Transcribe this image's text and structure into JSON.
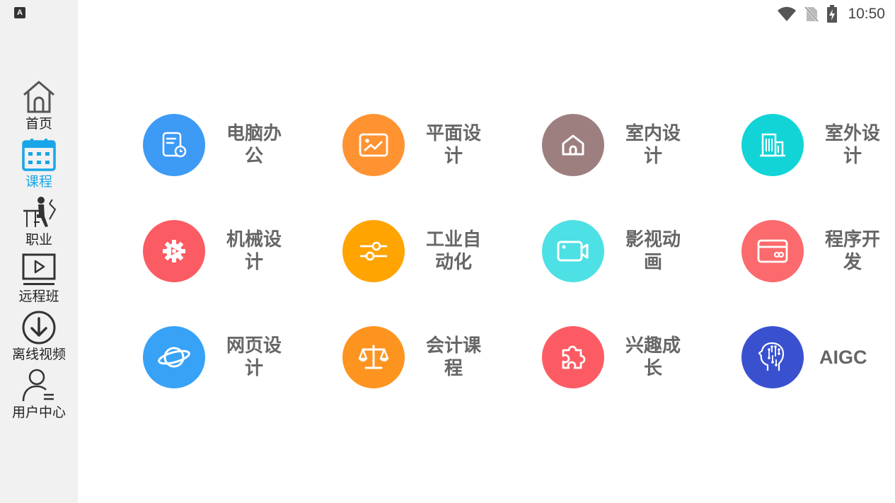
{
  "status": {
    "time": "10:50"
  },
  "app_badge": "A",
  "sidebar": {
    "items": [
      {
        "label": "首页"
      },
      {
        "label": "课程"
      },
      {
        "label": "职业"
      },
      {
        "label": "远程班"
      },
      {
        "label": "离线视频"
      },
      {
        "label": "用户中心"
      }
    ],
    "active_index": 1,
    "active_color": "#18a6e8"
  },
  "categories": [
    {
      "line1": "电脑办",
      "line2": "公",
      "color": "#3d9af5",
      "icon": "document-clock-icon"
    },
    {
      "line1": "平面设",
      "line2": "计",
      "color": "#ff9332",
      "icon": "picture-icon"
    },
    {
      "line1": "室内设",
      "line2": "计",
      "color": "#9d7f80",
      "icon": "house-icon"
    },
    {
      "line1": "室外设",
      "line2": "计",
      "color": "#12d4d6",
      "icon": "building-icon"
    },
    {
      "line1": "机械设",
      "line2": "计",
      "color": "#fb5b62",
      "icon": "gear-icon"
    },
    {
      "line1": "工业自",
      "line2": "动化",
      "color": "#ffa400",
      "icon": "sliders-icon"
    },
    {
      "line1": "影视动",
      "line2": "画",
      "color": "#4de0e4",
      "icon": "video-camera-icon"
    },
    {
      "line1": "程序开",
      "line2": "发",
      "color": "#fb6a6c",
      "icon": "card-code-icon"
    },
    {
      "line1": "网页设",
      "line2": "计",
      "color": "#37a2f6",
      "icon": "planet-icon"
    },
    {
      "line1": "会计课",
      "line2": "程",
      "color": "#fd9420",
      "icon": "scale-icon"
    },
    {
      "line1": "兴趣成",
      "line2": "长",
      "color": "#fd5b63",
      "icon": "puzzle-icon"
    },
    {
      "line1": "AIGC",
      "line2": "",
      "color": "#3a51cf",
      "icon": "ai-head-icon"
    }
  ]
}
